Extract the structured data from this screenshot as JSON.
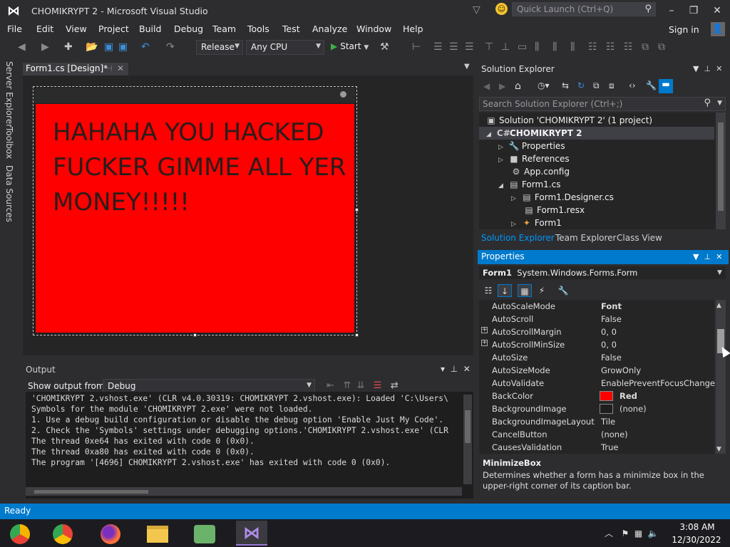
{
  "window": {
    "title": "CHOMIKRYPT 2 - Microsoft Visual Studio",
    "quick_launch_placeholder": "Quick Launch (Ctrl+Q)",
    "minimize_icon": "minimize-icon",
    "maximize_icon": "restore-icon",
    "close_icon": "close-icon"
  },
  "menu": [
    "File",
    "Edit",
    "View",
    "Project",
    "Build",
    "Debug",
    "Team",
    "Tools",
    "Test",
    "Analyze",
    "Window",
    "Help"
  ],
  "account": {
    "sign_in": "Sign in"
  },
  "toolbar": {
    "configuration": "Release",
    "platform": "Any CPU",
    "start_label": "Start"
  },
  "left_tabs": [
    "Server Explorer",
    "Toolbox",
    "Data Sources"
  ],
  "document_tab": {
    "label": "Form1.cs [Design]*"
  },
  "form_designer": {
    "message": "HAHAHA YOU HACKED FUCKER GIMME ALL YER MONEY!!!!!",
    "back_color": "#ff0000"
  },
  "output": {
    "title": "Output",
    "show_from_label": "Show output from:",
    "show_from_value": "Debug",
    "lines": [
      "'CHOMIKRYPT 2.vshost.exe' (CLR v4.0.30319: CHOMIKRYPT 2.vshost.exe): Loaded 'C:\\Users\\",
      "Symbols for the module 'CHOMIKRYPT 2.exe' were not loaded.",
      "",
      "1. Use a debug build configuration or disable the debug option 'Enable Just My Code'.",
      "2. Check the 'Symbols' settings under debugging options.'CHOMIKRYPT 2.vshost.exe' (CLR",
      "The thread 0xe64 has exited with code 0 (0x0).",
      "The thread 0xa80 has exited with code 0 (0x0).",
      "The program '[4696] CHOMIKRYPT 2.vshost.exe' has exited with code 0 (0x0)."
    ]
  },
  "solution_explorer": {
    "title": "Solution Explorer",
    "search_placeholder": "Search Solution Explorer (Ctrl+;)",
    "tree": [
      {
        "label": "Solution 'CHOMIKRYPT 2' (1 project)",
        "icon": "solution-icon"
      },
      {
        "label": "CHOMIKRYPT 2",
        "icon": "csharp-project-icon"
      },
      {
        "label": "Properties",
        "icon": "wrench-icon"
      },
      {
        "label": "References",
        "icon": "references-icon"
      },
      {
        "label": "App.config",
        "icon": "config-file-icon"
      },
      {
        "label": "Form1.cs",
        "icon": "form-icon"
      },
      {
        "label": "Form1.Designer.cs",
        "icon": "cs-file-icon"
      },
      {
        "label": "Form1.resx",
        "icon": "resx-file-icon"
      },
      {
        "label": "Form1",
        "icon": "class-icon"
      }
    ],
    "tabs": [
      "Solution Explorer",
      "Team Explorer",
      "Class View"
    ]
  },
  "properties": {
    "title": "Properties",
    "object_name": "Form1",
    "object_type": "System.Windows.Forms.Form",
    "rows": [
      {
        "name": "AutoScaleMode",
        "value": "Font",
        "bold": true
      },
      {
        "name": "AutoScroll",
        "value": "False"
      },
      {
        "name": "AutoScrollMargin",
        "value": "0, 0",
        "expandable": true
      },
      {
        "name": "AutoScrollMinSize",
        "value": "0, 0",
        "expandable": true
      },
      {
        "name": "AutoSize",
        "value": "False"
      },
      {
        "name": "AutoSizeMode",
        "value": "GrowOnly"
      },
      {
        "name": "AutoValidate",
        "value": "EnablePreventFocusChange"
      },
      {
        "name": "BackColor",
        "value": "Red",
        "bold": true,
        "swatch": "#ff0000"
      },
      {
        "name": "BackgroundImage",
        "value": "(none)",
        "swatch": "#1e1e1e"
      },
      {
        "name": "BackgroundImageLayout",
        "value": "Tile"
      },
      {
        "name": "CancelButton",
        "value": "(none)"
      },
      {
        "name": "CausesValidation",
        "value": "True"
      }
    ],
    "description_title": "MinimizeBox",
    "description_text": "Determines whether a form has a minimize box in the upper-right corner of its caption bar."
  },
  "status": {
    "text": "Ready"
  },
  "taskbar": {
    "apps": [
      "chrome-canary-icon",
      "chrome-icon",
      "firefox-icon",
      "file-explorer-icon",
      "network-app-icon",
      "visual-studio-icon"
    ],
    "time": "3:08 AM",
    "date": "12/30/2022"
  },
  "colors": {
    "accent": "#007acc",
    "chrome_bg": "#2d2d30",
    "panel_bg": "#252526"
  }
}
